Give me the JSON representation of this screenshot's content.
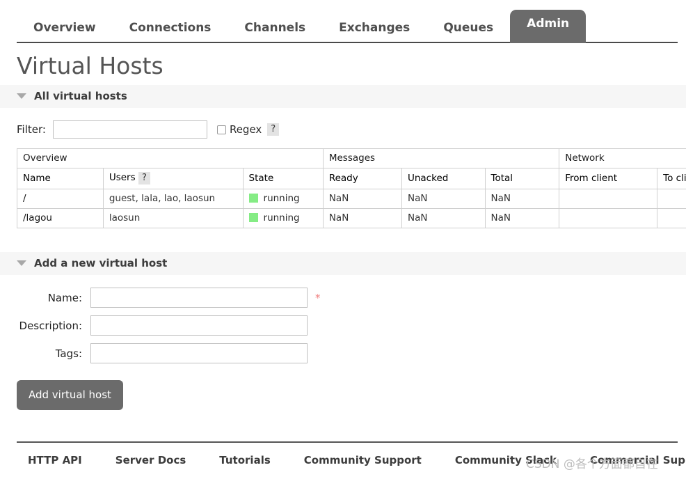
{
  "nav": {
    "tabs": [
      {
        "label": "Overview",
        "active": false
      },
      {
        "label": "Connections",
        "active": false
      },
      {
        "label": "Channels",
        "active": false
      },
      {
        "label": "Exchanges",
        "active": false
      },
      {
        "label": "Queues",
        "active": false
      },
      {
        "label": "Admin",
        "active": true
      }
    ]
  },
  "page": {
    "title": "Virtual Hosts"
  },
  "all_vhosts": {
    "section_title": "All virtual hosts",
    "filter": {
      "label": "Filter:",
      "value": "",
      "placeholder": "",
      "regex_label": "Regex",
      "regex_checked": false,
      "help_label": "?"
    },
    "table": {
      "groups": [
        {
          "label": "Overview",
          "span": 3
        },
        {
          "label": "Messages",
          "span": 3
        },
        {
          "label": "Network",
          "span": 2
        }
      ],
      "columns": [
        {
          "label": "Name",
          "bold": true,
          "align": "left"
        },
        {
          "label": "Users",
          "bold": false,
          "align": "left",
          "help": "?"
        },
        {
          "label": "State",
          "bold": false,
          "align": "left"
        },
        {
          "label": "Ready",
          "bold": true,
          "align": "right"
        },
        {
          "label": "Unacked",
          "bold": true,
          "align": "left"
        },
        {
          "label": "Total",
          "bold": true,
          "align": "left"
        },
        {
          "label": "From client",
          "bold": true,
          "align": "left"
        },
        {
          "label": "To client",
          "bold": true,
          "align": "left"
        }
      ],
      "rows": [
        {
          "name": "/",
          "users": "guest, lala, lao, laosun",
          "state": "running",
          "state_color": "#85ec85",
          "ready": "NaN",
          "unacked": "NaN",
          "total": "NaN",
          "from_client": "",
          "to_client": ""
        },
        {
          "name": "/lagou",
          "users": "laosun",
          "state": "running",
          "state_color": "#85ec85",
          "ready": "NaN",
          "unacked": "NaN",
          "total": "NaN",
          "from_client": "",
          "to_client": ""
        }
      ]
    }
  },
  "add_vhost": {
    "section_title": "Add a new virtual host",
    "fields": [
      {
        "label": "Name:",
        "value": "",
        "placeholder": "",
        "required": true,
        "required_mark": "*"
      },
      {
        "label": "Description:",
        "value": "",
        "placeholder": "",
        "required": false
      },
      {
        "label": "Tags:",
        "value": "",
        "placeholder": "",
        "required": false
      }
    ],
    "submit_label": "Add virtual host"
  },
  "footer": {
    "links": [
      {
        "label": "HTTP API"
      },
      {
        "label": "Server Docs"
      },
      {
        "label": "Tutorials"
      },
      {
        "label": "Community Support"
      },
      {
        "label": "Community Slack"
      },
      {
        "label": "Commercial Support"
      }
    ]
  },
  "watermark": {
    "text": "CSDN @各个方面都自在"
  }
}
